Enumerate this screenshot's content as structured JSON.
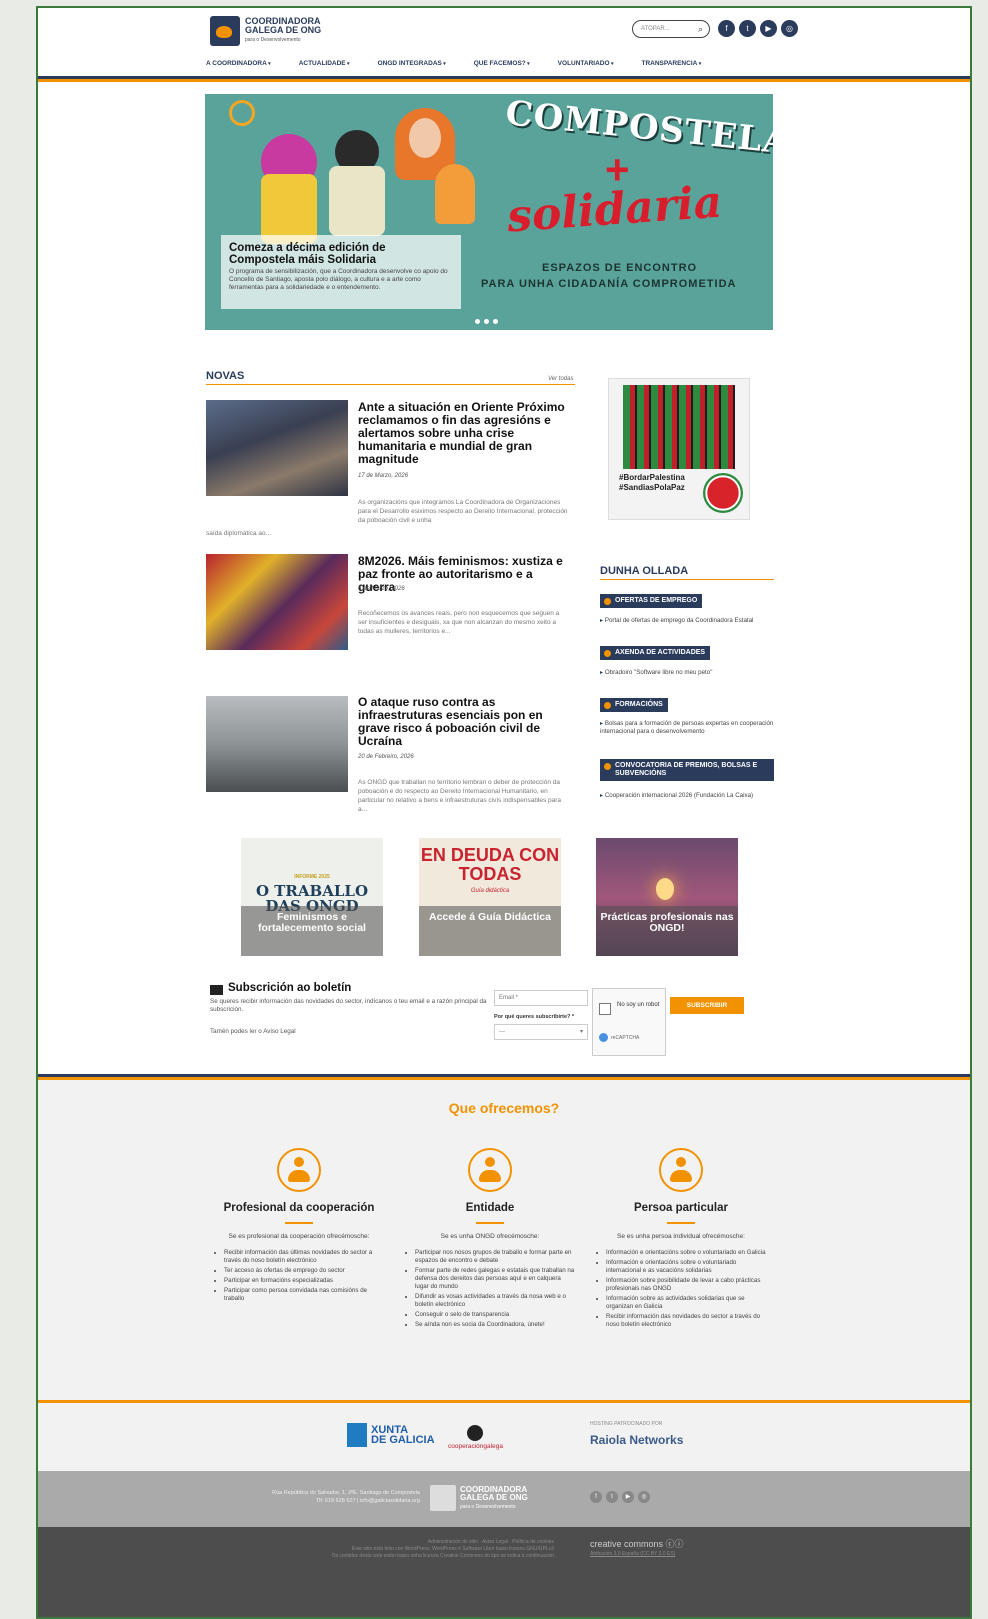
{
  "header": {
    "logo_line1": "COORDINADORA",
    "logo_line2": "GALEGA DE ONG",
    "logo_sub": "para o Desenvolvemento",
    "search_placeholder": "ATOPAR...",
    "social_icons": [
      "facebook-icon",
      "twitter-icon",
      "youtube-icon",
      "instagram-icon"
    ]
  },
  "nav": [
    "A COORDINADORA",
    "ACTUALIDADE",
    "ONGD INTEGRADAS",
    "QUE FACEMOS?",
    "VOLUNTARIADO",
    "TRANSPARENCIA"
  ],
  "hero": {
    "title_word": "COMPOSTELA",
    "plus": "+",
    "script_word": "solidaria",
    "tagline1": "ESPAZOS DE ENCONTRO",
    "tagline2": "PARA UNHA CIDADANÍA COMPROMETIDA",
    "caption_title": "Comeza a décima edición de Compostela máis Solidaria",
    "caption_desc": "O programa de sensibilización, que a Coordinadora desenvolve co apoio do Concello de Santiago, aposta polo diálogo, a cultura e a arte como ferramentas para a solidariedade e o entendemento.",
    "slides": 3
  },
  "news": {
    "title": "NOVAS",
    "see_all": "Ver todas",
    "items": [
      {
        "title": "Ante a situación en Oriente Próximo reclamamos o fin das agresións e alertamos sobre unha crise humanitaria e mundial de gran magnitude",
        "date": "17 de Marzo, 2026",
        "excerpt": "As organizacións que integramos La Coordinadora de Organizaciones para el Desarrollo esiximos respecto ao Dereito Internacional, protección da poboación civil e unha",
        "excerpt_cont": "saída diplomática ao..."
      },
      {
        "title": "8M2026. Máis feminismos: xustiza e paz fronte ao autoritarismo e a guerra",
        "date": "6 de Marzo, 2026",
        "excerpt": "Recoñecemos os avances reais, pero non esquecemos que seguen a ser insuficientes e desiguais, xa que non alcanzan do mesmo xeito a todas as mulleres, territorios e..."
      },
      {
        "title": "O ataque ruso contra as infraestruturas esenciais pon en grave risco á poboación civil de Ucraína",
        "date": "20 de Febreiro, 2026",
        "excerpt": "As ONGD que traballan no territorio lembran o deber de protección da poboación e do respecto ao Dereito Internacional Humanitario, en particular no relativo a bens e infraestruturas civís indispensables para a..."
      }
    ]
  },
  "sidebar": {
    "campaign_tag1": "#BordarPalestina",
    "campaign_tag2": "#SandiasPolaPaz",
    "title": "DUNHA OLLADA",
    "blocks": [
      {
        "label": "OFERTAS DE EMPREGO",
        "link": "Portal de ofertas de emprego da Coordinadora Estatal"
      },
      {
        "label": "AXENDA DE ACTIVIDADES",
        "link": "Obradoiro \"Software libre no meu peto\""
      },
      {
        "label": "FORMACIÓNS",
        "link": "Bolsas para a formación de persoas expertas en cooperación internacional para o desenvolvemento"
      },
      {
        "label": "CONVOCATORIA DE PREMIOS, BOLSAS E SUBVENCIÓNS",
        "link": "Cooperación internacional 2026 (Fundación La Caixa)"
      }
    ]
  },
  "promos": [
    {
      "label": "Feminismos e fortalecemento social",
      "bg_text": "O TRABALLO DAS ONGD",
      "bg_tag": "INFORME 2025"
    },
    {
      "label": "Accede á Guía Didáctica",
      "bg_text": "EN DEUDA CON TODAS",
      "bg_tag": "Guía didáctica"
    },
    {
      "label": "Prácticas profesionais nas ONGD!"
    }
  ],
  "newsletter": {
    "title": "Subscrición ao boletín",
    "desc": "Se queres recibir información das novidades do sector, indícanos o teu email e a razón principal da subscrición.",
    "legal": "Tamén podes ler o Aviso Legal",
    "email_placeholder": "Email *",
    "question": "Por qué queres subscribirte? *",
    "select_value": "---",
    "captcha_text": "No soy un robot",
    "captcha_brand": "reCAPTCHA",
    "button": "SUBSCRIBIR"
  },
  "offer": {
    "title": "Que ofrecemos?",
    "columns": [
      {
        "heading": "Profesional da cooperación",
        "intro": "Se es profesional da cooperación ofrecémosche:",
        "items": [
          "Recibir información das últimas novidades do sector a través do noso boletín electrónico",
          "Ter acceso ás ofertas de emprego do sector",
          "Participar en formacións especializadas",
          "Participar como persoa convidada nas comisións de traballo"
        ]
      },
      {
        "heading": "Entidade",
        "intro": "Se es unha ONGD ofrecémosche:",
        "items": [
          "Participar nos nosos grupos de traballo e formar parte en espazos de encontro e debate",
          "Formar parte de redes galegas e estatais que traballan na defensa dos dereitos das persoas aquí e en calquera lugar do mundo",
          "Difundir as vosas actividades a través da nosa web e o boletín electrónico",
          "Conseguir o selo de transparencia",
          "Se aínda non es socia da Coordinadora, únete!"
        ]
      },
      {
        "heading": "Persoa particular",
        "intro": "Se es unha persoa individual ofrecémosche:",
        "items": [
          "Información e orientacións sobre o voluntariado en Galicia",
          "Información e orientacións sobre o voluntariado internacional e as vacacións solidarias",
          "Información sobre posibilidade de levar a cabo prácticas profesionais nas ONGD",
          "Información sobre as actividades solidarias que se organizan en Galicia",
          "Recibir información das novidades do sector a través do noso boletín electrónico"
        ]
      }
    ]
  },
  "sponsors": {
    "xunta_line1": "XUNTA",
    "xunta_line2": "DE GALICIA",
    "coop": "cooperacióngalega",
    "host_label": "HOSTING PATROCINADO POR",
    "host_name": "Raiola Networks"
  },
  "footer": {
    "address": "Rúa República do Salvador, 1, 2ºE. Santiago de Compostela",
    "contact": "Tlf: 619 628 627 | info@galiciasolidaria.org",
    "logo_line1": "COORDINADORA",
    "logo_line2": "GALEGA DE ONG",
    "logo_sub": "para o Desenvolvemento",
    "links": "Administración do sitio · Aviso Legal · Política de cookies",
    "credit": "Este sitio está feito con WordPress, WordPress é Software Libre baixo licenza GNU/GPLv3",
    "license_note": "Os contidos desta web están baixo unha licenza Creative Commons do tipo se indica á continuación",
    "cc_label": "creative commons",
    "license": "Atribución 3.0 España (CC BY 3.0 ES)"
  }
}
